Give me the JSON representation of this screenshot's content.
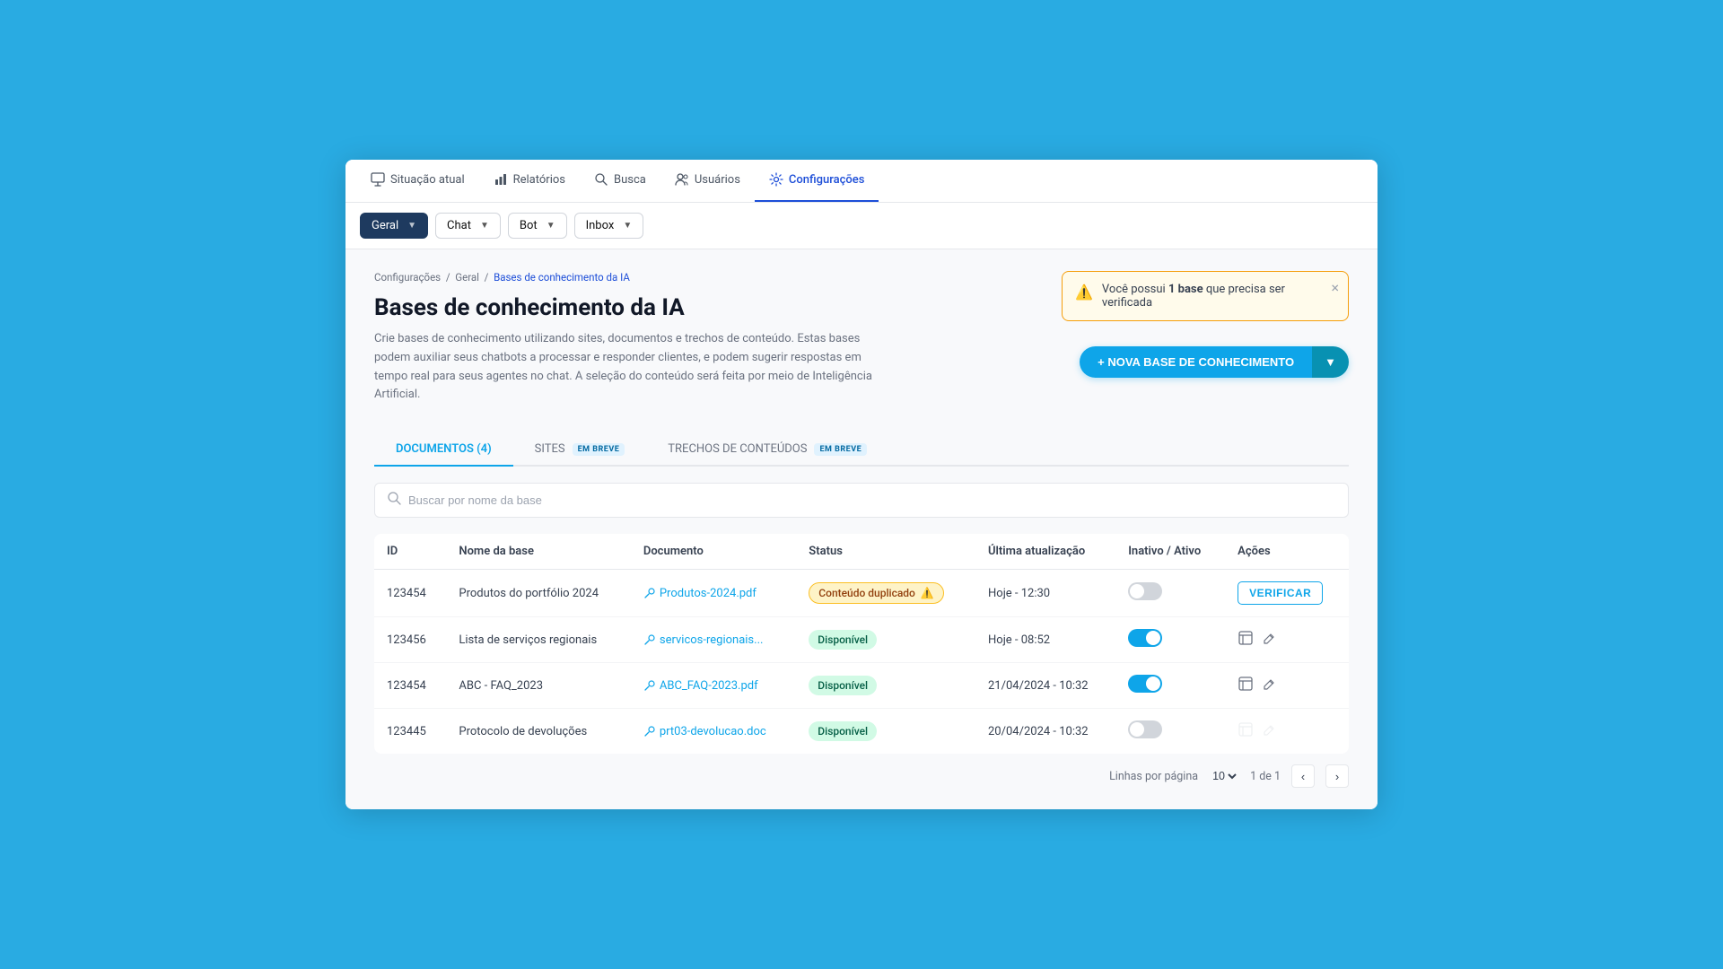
{
  "nav": {
    "items": [
      {
        "key": "situacao-atual",
        "label": "Situação atual",
        "icon": "monitor",
        "active": false
      },
      {
        "key": "relatorios",
        "label": "Relatórios",
        "icon": "bar-chart",
        "active": false
      },
      {
        "key": "busca",
        "label": "Busca",
        "icon": "search",
        "active": false
      },
      {
        "key": "usuarios",
        "label": "Usuários",
        "icon": "users",
        "active": false
      },
      {
        "key": "configuracoes",
        "label": "Configurações",
        "icon": "gear",
        "active": true
      }
    ]
  },
  "toolbar": {
    "geral_label": "Geral",
    "chat_label": "Chat",
    "bot_label": "Bot",
    "inbox_label": "Inbox"
  },
  "breadcrumb": {
    "parts": [
      "Configurações",
      "Geral",
      "Bases de conhecimento da IA"
    ],
    "links": [
      "Configurações",
      "Geral"
    ]
  },
  "page": {
    "title": "Bases de conhecimento da IA",
    "description": "Crie bases de conhecimento utilizando sites, documentos e trechos de conteúdo. Estas bases podem auxiliar seus chatbots a processar e responder clientes, e podem sugerir respostas em tempo real para seus agentes no chat. A seleção do conteúdo será feita por meio de Inteligência Artificial."
  },
  "alert": {
    "text_start": "Você possui ",
    "bold_text": "1 base",
    "text_end": " que precisa ser verificada"
  },
  "new_base_button": {
    "label": "+ NOVA BASE DE CONHECIMENTO"
  },
  "tabs": [
    {
      "key": "documentos",
      "label": "DOCUMENTOS (4)",
      "badge": null,
      "active": true
    },
    {
      "key": "sites",
      "label": "SITES",
      "badge": "EM BREVE",
      "active": false
    },
    {
      "key": "trechos",
      "label": "TRECHOS DE CONTEÚDOS",
      "badge": "EM BREVE",
      "active": false
    }
  ],
  "search": {
    "placeholder": "Buscar por nome da base"
  },
  "table": {
    "headers": [
      "ID",
      "Nome da base",
      "Documento",
      "Status",
      "Última atualização",
      "Inativo / Ativo",
      "Ações"
    ],
    "rows": [
      {
        "id": "123454",
        "name": "Produtos do portfólio 2024",
        "doc_link": "Produtos-2024.pdf",
        "status": "duplicado",
        "status_label": "Conteúdo duplicado",
        "updated": "Hoje - 12:30",
        "toggle": "off",
        "action": "verify"
      },
      {
        "id": "123456",
        "name": "Lista de serviços regionais",
        "doc_link": "servicos-regionais...",
        "status": "disponivel",
        "status_label": "Disponível",
        "updated": "Hoje - 08:52",
        "toggle": "on",
        "action": "icons"
      },
      {
        "id": "123454",
        "name": "ABC - FAQ_2023",
        "doc_link": "ABC_FAQ-2023.pdf",
        "status": "disponivel",
        "status_label": "Disponível",
        "updated": "21/04/2024 - 10:32",
        "toggle": "on",
        "action": "icons"
      },
      {
        "id": "123445",
        "name": "Protocolo de devoluções",
        "doc_link": "prt03-devolucao.doc",
        "status": "disponivel",
        "status_label": "Disponível",
        "updated": "20/04/2024 - 10:32",
        "toggle": "off",
        "action": "icons-disabled"
      }
    ]
  },
  "pagination": {
    "lines_per_page_label": "Linhas por página",
    "per_page": "10",
    "current_page": "1 de 1"
  }
}
